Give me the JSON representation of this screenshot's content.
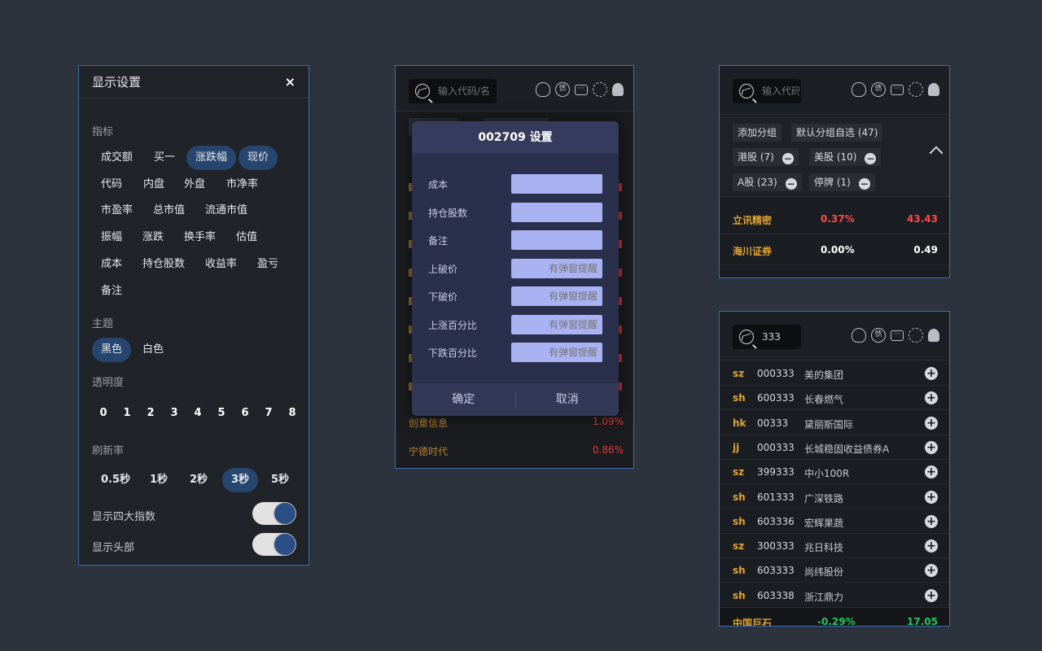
{
  "settings": {
    "title": "显示设置",
    "close": "×",
    "indicators_label": "指标",
    "indicators": [
      {
        "label": "成交额",
        "on": false
      },
      {
        "label": "买一",
        "on": false
      },
      {
        "label": "涨跌幅",
        "on": true
      },
      {
        "label": "现价",
        "on": true
      },
      {
        "label": "代码",
        "on": false
      },
      {
        "label": "内盘",
        "on": false
      },
      {
        "label": "外盘",
        "on": false
      },
      {
        "label": "市净率",
        "on": false
      },
      {
        "label": "市盈率",
        "on": false
      },
      {
        "label": "总市值",
        "on": false
      },
      {
        "label": "流通市值",
        "on": false
      },
      {
        "label": "振幅",
        "on": false
      },
      {
        "label": "涨跌",
        "on": false
      },
      {
        "label": "换手率",
        "on": false
      },
      {
        "label": "估值",
        "on": false
      },
      {
        "label": "成本",
        "on": false
      },
      {
        "label": "持仓股数",
        "on": false
      },
      {
        "label": "收益率",
        "on": false
      },
      {
        "label": "盈亏",
        "on": false
      },
      {
        "label": "备注",
        "on": false
      }
    ],
    "theme_label": "主题",
    "themes": [
      {
        "label": "黑色",
        "on": true
      },
      {
        "label": "白色",
        "on": false
      }
    ],
    "opacity_label": "透明度",
    "opacity_values": [
      "0",
      "1",
      "2",
      "3",
      "4",
      "5",
      "6",
      "7",
      "8"
    ],
    "refresh_label": "刷新率",
    "refresh_options": [
      {
        "label": "0.5秒",
        "on": false
      },
      {
        "label": "1秒",
        "on": false
      },
      {
        "label": "2秒",
        "on": false
      },
      {
        "label": "3秒",
        "on": true
      },
      {
        "label": "5秒",
        "on": false
      }
    ],
    "toggle_indices_label": "显示四大指数",
    "toggle_indices_on": true,
    "toggle_header_label": "显示头部",
    "toggle_header_on": true
  },
  "dialog_panel": {
    "search_placeholder": "输入代码/名",
    "bg_rows": [
      {
        "name": "创意信息",
        "value": "1.09%"
      },
      {
        "name": "宁德时代",
        "value": "0.86%"
      }
    ],
    "dialog": {
      "title": "002709 设置",
      "fields": [
        {
          "label": "成本",
          "placeholder": ""
        },
        {
          "label": "持仓股数",
          "placeholder": ""
        },
        {
          "label": "备注",
          "placeholder": ""
        },
        {
          "label": "上破价",
          "placeholder": "有弹窗提醒"
        },
        {
          "label": "下破价",
          "placeholder": "有弹窗提醒"
        },
        {
          "label": "上涨百分比",
          "placeholder": "有弹窗提醒"
        },
        {
          "label": "下跌百分比",
          "placeholder": "有弹窗提醒"
        }
      ],
      "confirm": "确定",
      "cancel": "取消"
    }
  },
  "groups_panel": {
    "search_placeholder": "输入代码",
    "add_group": "添加分组",
    "default_group": "默认分组自选 (47)",
    "groups": [
      "港股 (7)",
      "美股 (10)",
      "A股 (23)",
      "停牌 (1)"
    ],
    "stocks": [
      {
        "name": "立讯精密",
        "pct": "0.37%",
        "price": "43.43",
        "color": "#ff4a4a"
      },
      {
        "name": "海川证券",
        "pct": "0.00%",
        "price": "0.49",
        "color": "#ffffff"
      }
    ]
  },
  "search_panel": {
    "query": "333",
    "results": [
      {
        "market": "sz",
        "code": "000333",
        "name": "美的集团"
      },
      {
        "market": "sh",
        "code": "600333",
        "name": "长春燃气"
      },
      {
        "market": "hk",
        "code": "00333",
        "name": "黛丽斯国际"
      },
      {
        "market": "jj",
        "code": "000333",
        "name": "长城稳固收益债券A"
      },
      {
        "market": "sz",
        "code": "399333",
        "name": "中小100R"
      },
      {
        "market": "sh",
        "code": "601333",
        "name": "广深铁路"
      },
      {
        "market": "sh",
        "code": "603336",
        "name": "宏辉果蔬"
      },
      {
        "market": "sz",
        "code": "300333",
        "name": "兆日科技"
      },
      {
        "market": "sh",
        "code": "603333",
        "name": "尚纬股份"
      },
      {
        "market": "sh",
        "code": "603338",
        "name": "浙江鼎力"
      }
    ],
    "footer_stock": {
      "name": "中国巨石",
      "pct": "-0.29%",
      "price": "17.05"
    }
  }
}
